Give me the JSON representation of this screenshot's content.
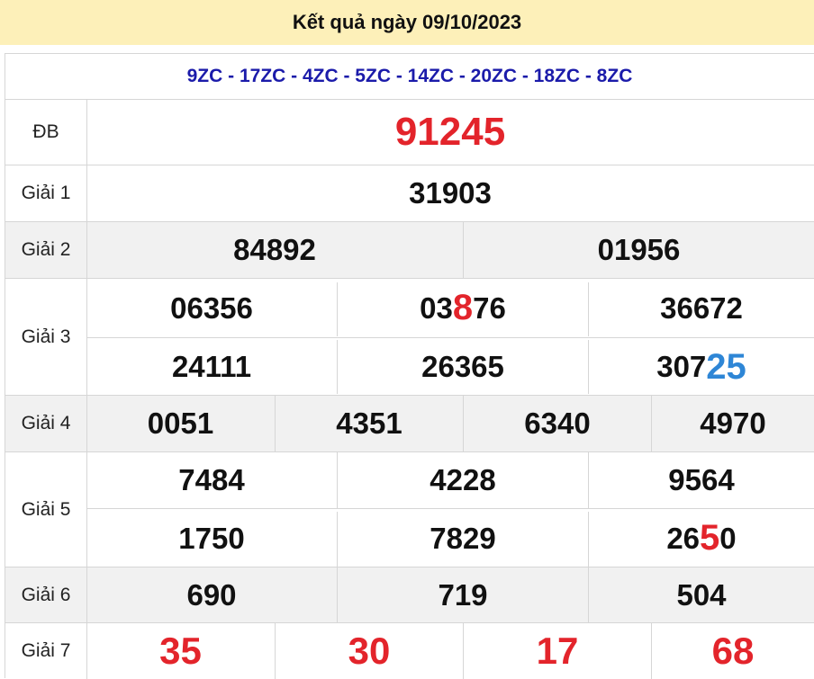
{
  "header": {
    "title": "Kết quả ngày 09/10/2023"
  },
  "codes": "9ZC - 17ZC - 4ZC - 5ZC - 14ZC - 20ZC - 18ZC - 8ZC",
  "prizes": {
    "db": {
      "label": "ĐB",
      "value": "91245"
    },
    "g1": {
      "label": "Giải 1",
      "values": [
        "31903"
      ]
    },
    "g2": {
      "label": "Giải 2",
      "values": [
        "84892",
        "01956"
      ]
    },
    "g3": {
      "label": "Giải 3",
      "row1": [
        "06356",
        {
          "pre": "03",
          "hl": "8",
          "post": "76"
        },
        "36672"
      ],
      "row2": [
        "24111",
        "26365",
        {
          "pre": "307",
          "hl": "25",
          "post": ""
        }
      ]
    },
    "g4": {
      "label": "Giải 4",
      "values": [
        "0051",
        "4351",
        "6340",
        "4970"
      ]
    },
    "g5": {
      "label": "Giải 5",
      "row1": [
        "7484",
        "4228",
        "9564"
      ],
      "row2": [
        "1750",
        "7829",
        {
          "pre": "26",
          "hl": "5",
          "post": "0"
        }
      ]
    },
    "g6": {
      "label": "Giải 6",
      "values": [
        "690",
        "719",
        "504"
      ]
    },
    "g7": {
      "label": "Giải 7",
      "values": [
        "35",
        "30",
        "17",
        "68"
      ]
    }
  },
  "colors": {
    "header_bg": "#fdf0b9",
    "codes": "#1b1baa",
    "highlight_red": "#e3242b",
    "highlight_blue": "#2e86d6",
    "alt_row": "#f1f1f1"
  }
}
